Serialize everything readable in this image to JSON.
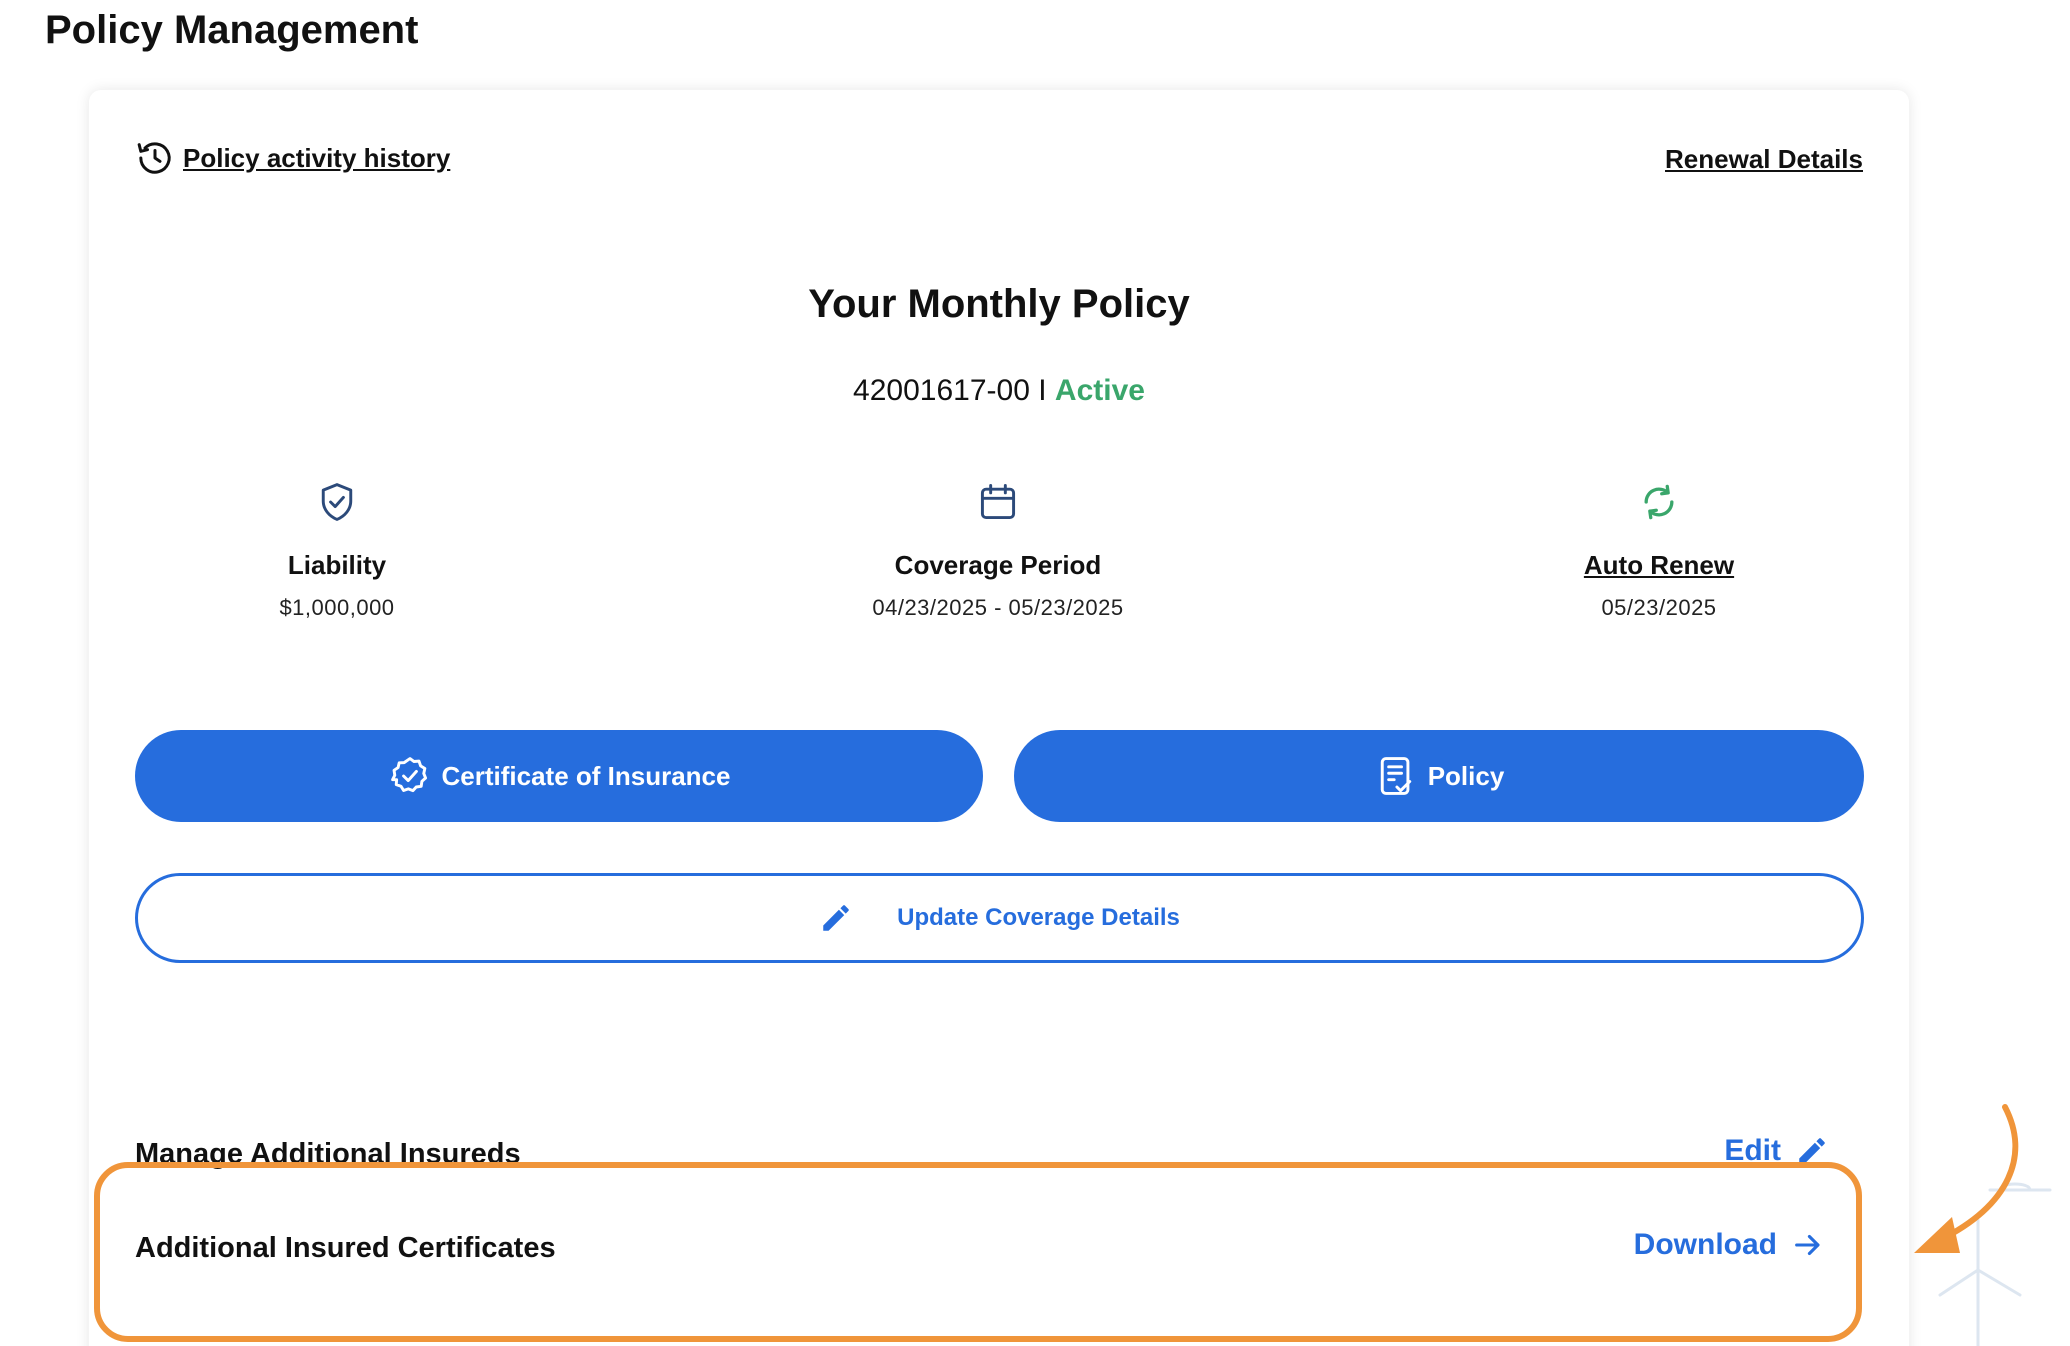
{
  "page": {
    "title": "Policy Management"
  },
  "header": {
    "history_link": "Policy activity history",
    "renewal_link": "Renewal Details"
  },
  "policy": {
    "heading": "Your Monthly Policy",
    "number": "42001617-00",
    "separator": " I ",
    "status": "Active",
    "status_color": "#3aa66b"
  },
  "stats": {
    "liability": {
      "icon": "shield-check-icon",
      "label": "Liability",
      "value": "$1,000,000"
    },
    "coverage": {
      "icon": "calendar-icon",
      "label": "Coverage Period",
      "value": "04/23/2025 - 05/23/2025"
    },
    "auto_renew": {
      "icon": "refresh-icon",
      "label": "Auto Renew",
      "value": "05/23/2025"
    }
  },
  "buttons": {
    "certificate": "Certificate of Insurance",
    "policy": "Policy",
    "update_coverage": "Update Coverage Details"
  },
  "additional_insureds": {
    "label": "Manage Additional Insureds",
    "action": "Edit"
  },
  "certificates": {
    "label": "Additional Insured Certificates",
    "action": "Download"
  },
  "colors": {
    "primary": "#266ddd",
    "highlight": "#f0953a",
    "success": "#3aa66b"
  }
}
